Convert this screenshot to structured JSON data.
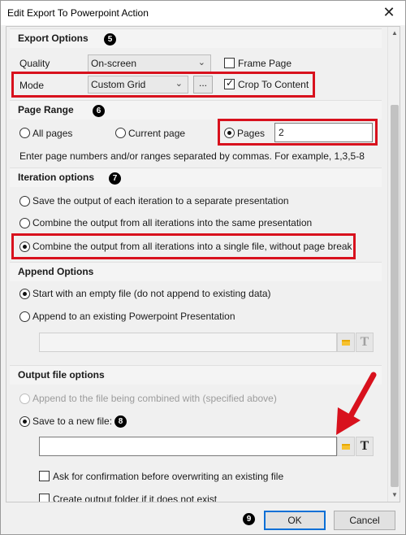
{
  "window": {
    "title": "Edit Export To Powerpoint Action",
    "close_glyph": "✕"
  },
  "export_options": {
    "heading": "Export Options",
    "badge": "5",
    "quality_label": "Quality",
    "quality_value": "On-screen",
    "frame_page_label": "Frame Page",
    "frame_page_checked": false,
    "mode_label": "Mode",
    "mode_value": "Custom Grid",
    "mode_more_label": "...",
    "crop_label": "Crop To Content",
    "crop_checked": true
  },
  "page_range": {
    "heading": "Page Range",
    "badge": "6",
    "all_pages_label": "All pages",
    "current_page_label": "Current page",
    "pages_label": "Pages",
    "selected": "Pages",
    "pages_value": "2",
    "hint": "Enter page numbers and/or ranges separated by commas. For example, 1,3,5-8"
  },
  "iteration_options": {
    "heading": "Iteration options",
    "badge": "7",
    "options": [
      "Save the output of each iteration to a separate presentation",
      "Combine the output from all iterations into the same presentation",
      "Combine the output from all iterations into a single file, without page break"
    ],
    "selected": "Combine the output from all iterations into a single file, without page break"
  },
  "append_options": {
    "heading": "Append Options",
    "options": [
      "Start with an empty file (do not append to existing data)",
      "Append to an existing Powerpoint Presentation"
    ],
    "selected": "Start with an empty file (do not append to existing data)",
    "path_value": ""
  },
  "output_file_options": {
    "heading": "Output file options",
    "append_combined_label": "Append to the file being combined with (specified above)",
    "save_new_label": "Save to a new file:",
    "selected": "Save to a new file:",
    "badge": "8",
    "file_value": "",
    "confirm_overwrite_label": "Ask for confirmation before overwriting an existing file",
    "confirm_overwrite_checked": false,
    "create_folder_label": "Create output folder if it does not exist",
    "create_folder_checked": false
  },
  "icons": {
    "folder": "folder-icon",
    "text_field": "text-field-icon",
    "close": "close-icon",
    "chevron": "chevron-down-icon"
  },
  "footer": {
    "badge": "9",
    "ok_label": "OK",
    "cancel_label": "Cancel"
  },
  "colors": {
    "highlight_red": "#d8111d",
    "default_button_border": "#0a6fd6",
    "folder_yellow": "#f6c12f"
  }
}
